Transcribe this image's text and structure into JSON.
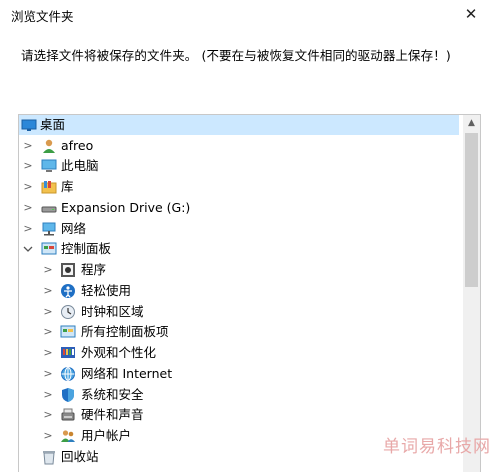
{
  "window": {
    "title": "浏览文件夹",
    "close_glyph": "✕"
  },
  "instruction": "请选择文件将被保存的文件夹。 (不要在与被恢复文件相同的驱动器上保存！)",
  "tree": {
    "items": [
      {
        "label": "桌面",
        "icon": "desktop-icon",
        "selected": true
      },
      {
        "label": "afreo",
        "icon": "user-icon",
        "expander": "collapsed"
      },
      {
        "label": "此电脑",
        "icon": "computer-icon",
        "expander": "collapsed"
      },
      {
        "label": "库",
        "icon": "library-icon",
        "expander": "collapsed"
      },
      {
        "label": "Expansion Drive (G:)",
        "icon": "drive-icon",
        "expander": "collapsed"
      },
      {
        "label": "网络",
        "icon": "network-icon",
        "expander": "collapsed"
      },
      {
        "label": "控制面板",
        "icon": "control-panel-icon",
        "expander": "expanded"
      },
      {
        "label": "程序",
        "icon": "programs-icon",
        "expander": "collapsed"
      },
      {
        "label": "轻松使用",
        "icon": "ease-of-access-icon",
        "expander": "collapsed"
      },
      {
        "label": "时钟和区域",
        "icon": "clock-region-icon",
        "expander": "collapsed"
      },
      {
        "label": "所有控制面板项",
        "icon": "all-control-panel-icon",
        "expander": "collapsed"
      },
      {
        "label": "外观和个性化",
        "icon": "appearance-icon",
        "expander": "collapsed"
      },
      {
        "label": "网络和 Internet",
        "icon": "network-internet-icon",
        "expander": "collapsed"
      },
      {
        "label": "系统和安全",
        "icon": "system-security-icon",
        "expander": "collapsed"
      },
      {
        "label": "硬件和声音",
        "icon": "hardware-sound-icon",
        "expander": "collapsed"
      },
      {
        "label": "用户帐户",
        "icon": "user-accounts-icon",
        "expander": "collapsed"
      },
      {
        "label": "回收站",
        "icon": "recycle-bin-icon"
      }
    ]
  },
  "scrollbar": {
    "up_glyph": "▲"
  },
  "watermark": "单词易科技网"
}
